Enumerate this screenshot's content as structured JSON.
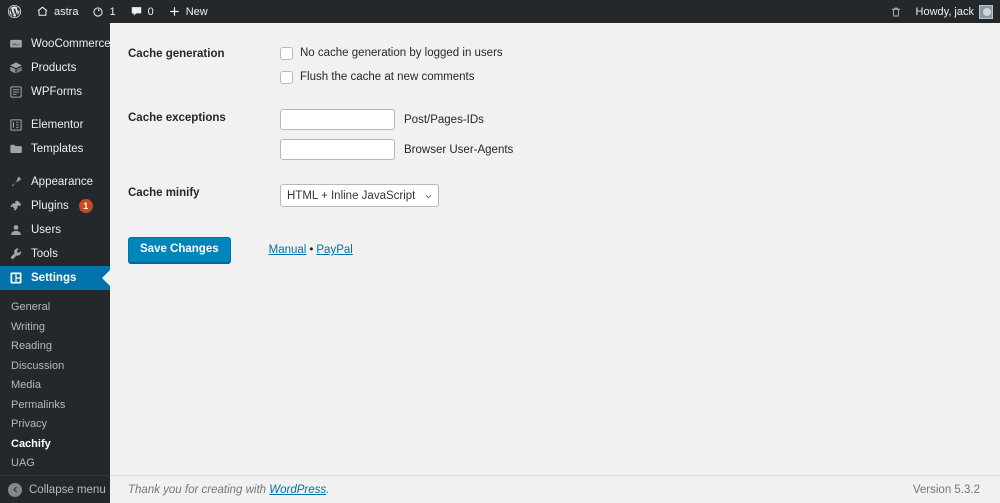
{
  "adminbar": {
    "logo_icon": "wordpress-icon",
    "site_icon": "home-icon",
    "site_name": "astra",
    "updates_icon": "updates-icon",
    "updates_count": "1",
    "comments_icon": "comments-icon",
    "comments_count": "0",
    "new_icon": "plus-icon",
    "new_label": "New",
    "trash_icon": "trash-icon",
    "howdy": "Howdy, jack",
    "avatar_icon": "avatar-icon"
  },
  "sidebar": {
    "items": [
      {
        "label": "WooCommerce",
        "icon": "woocommerce-icon"
      },
      {
        "label": "Products",
        "icon": "products-icon"
      },
      {
        "label": "WPForms",
        "icon": "wpforms-icon"
      },
      {
        "label": "Elementor",
        "icon": "elementor-icon"
      },
      {
        "label": "Templates",
        "icon": "templates-icon"
      },
      {
        "label": "Appearance",
        "icon": "appearance-icon"
      },
      {
        "label": "Plugins",
        "icon": "plugins-icon",
        "badge": "1"
      },
      {
        "label": "Users",
        "icon": "users-icon"
      },
      {
        "label": "Tools",
        "icon": "tools-icon"
      },
      {
        "label": "Settings",
        "icon": "settings-icon",
        "current": true
      }
    ],
    "submenu": [
      {
        "label": "General"
      },
      {
        "label": "Writing"
      },
      {
        "label": "Reading"
      },
      {
        "label": "Discussion"
      },
      {
        "label": "Media"
      },
      {
        "label": "Permalinks"
      },
      {
        "label": "Privacy"
      },
      {
        "label": "Cachify",
        "current": true
      },
      {
        "label": "UAG"
      }
    ],
    "collapse_label": "Collapse menu",
    "collapse_icon": "chevron-left-icon"
  },
  "settings": {
    "rows": [
      {
        "label": "Cache generation",
        "checkboxes": [
          {
            "label": "No cache generation by logged in users",
            "checked": false
          },
          {
            "label": "Flush the cache at new comments",
            "checked": false
          }
        ]
      },
      {
        "label": "Cache exceptions",
        "fields": [
          {
            "value": "",
            "placeholder": "",
            "desc": "Post/Pages-IDs"
          },
          {
            "value": "",
            "placeholder": "",
            "desc": "Browser User-Agents"
          }
        ]
      },
      {
        "label": "Cache minify",
        "select": {
          "value": "HTML + Inline JavaScript",
          "options": [
            "HTML + Inline JavaScript"
          ]
        }
      }
    ],
    "save_label": "Save Changes",
    "manual_link": "Manual",
    "separator": "•",
    "paypal_link": "PayPal"
  },
  "footer": {
    "thanks_prefix": "Thank you for creating with ",
    "wordpress_link": "WordPress",
    "thanks_suffix": ".",
    "version": "Version 5.3.2"
  },
  "colors": {
    "sidebar_bg": "#23282d",
    "accent": "#0073aa",
    "button": "#0085ba",
    "badge": "#ca4a1f",
    "content_bg": "#f1f1f1"
  }
}
